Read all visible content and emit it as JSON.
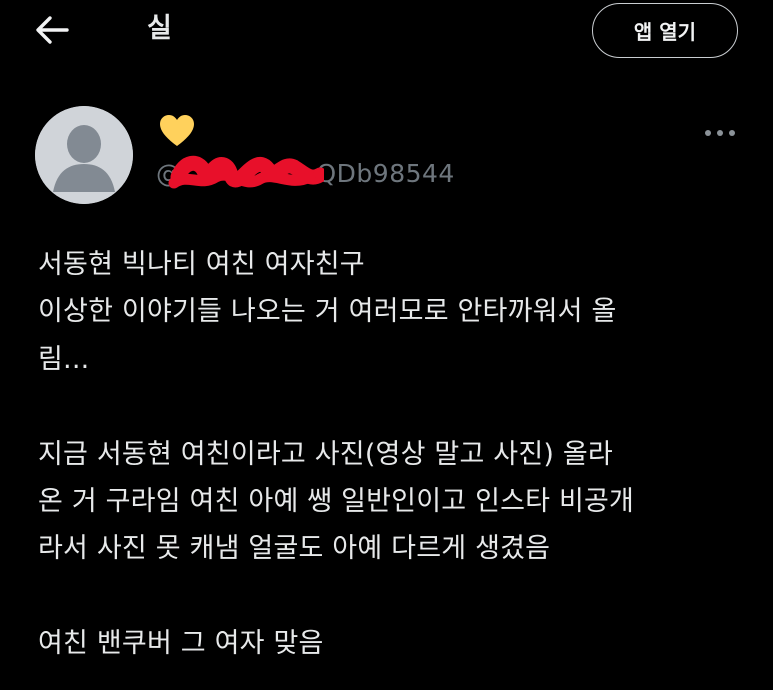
{
  "header": {
    "title": "실",
    "open_app_label": "앱 열기"
  },
  "author": {
    "handle_visible": "@",
    "handle_suffix": "QDb98544",
    "badge_icon": "yellow-heart-icon",
    "badge_color": "#ffd15c",
    "redaction_color": "#e8102a"
  },
  "post": {
    "paragraph1": [
      "서동현 빅나티 여친 여자친구",
      "이상한 이야기들 나오는 거 여러모로 안타까워서 올",
      "림..."
    ],
    "paragraph2": [
      "지금 서동현 여친이라고 사진(영상 말고 사진) 올라",
      "온 거 구라임 여친 아예 쌩 일반인이고 인스타 비공개",
      "라서 사진 못 캐냄 얼굴도 아예 다르게 생겼음"
    ],
    "paragraph3": [
      "여친 밴쿠버 그 여자 맞음"
    ]
  },
  "colors": {
    "background": "#000000",
    "text": "#e7e9ea",
    "muted": "#6e767d"
  }
}
